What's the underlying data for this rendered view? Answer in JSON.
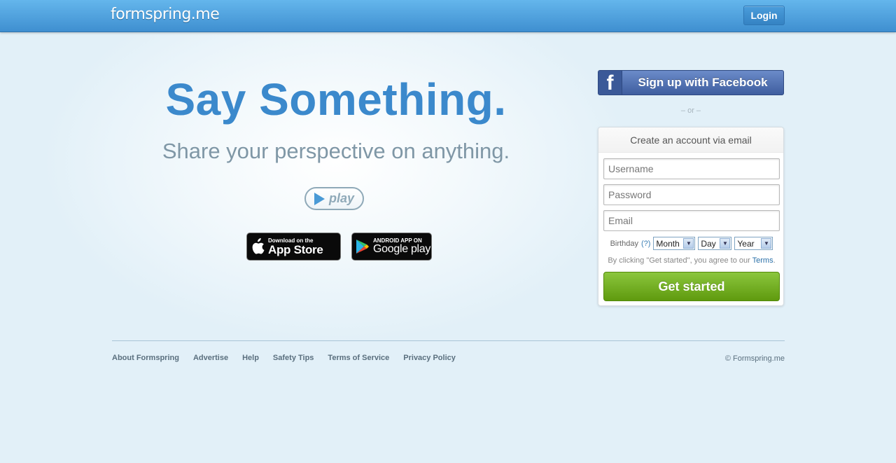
{
  "header": {
    "logo": "formspring.me",
    "login_label": "Login"
  },
  "hero": {
    "title": "Say Something.",
    "subtitle": "Share your perspective on anything.",
    "play_label": "play",
    "app_store": {
      "small": "Download on the",
      "big": "App Store"
    },
    "google_play": {
      "small": "ANDROID APP ON",
      "big": "Google play"
    }
  },
  "signup": {
    "facebook_label": "Sign up with Facebook",
    "or_text": "– or –",
    "box_title": "Create an account via email",
    "username_placeholder": "Username",
    "password_placeholder": "Password",
    "email_placeholder": "Email",
    "birthday_label": "Birthday",
    "birthday_help": "(?)",
    "month": "Month",
    "day": "Day",
    "year": "Year",
    "terms_prefix": "By clicking \"Get started\", you agree to our ",
    "terms_link": "Terms",
    "terms_suffix": ".",
    "submit_label": "Get started"
  },
  "footer": {
    "links": [
      "About Formspring",
      "Advertise",
      "Help",
      "Safety Tips",
      "Terms of Service",
      "Privacy Policy"
    ],
    "copyright": "© Formspring.me"
  },
  "colors": {
    "header": "#4a9ddb",
    "title": "#3b89cc",
    "facebook": "#3b5998",
    "submit": "#76b12a"
  }
}
